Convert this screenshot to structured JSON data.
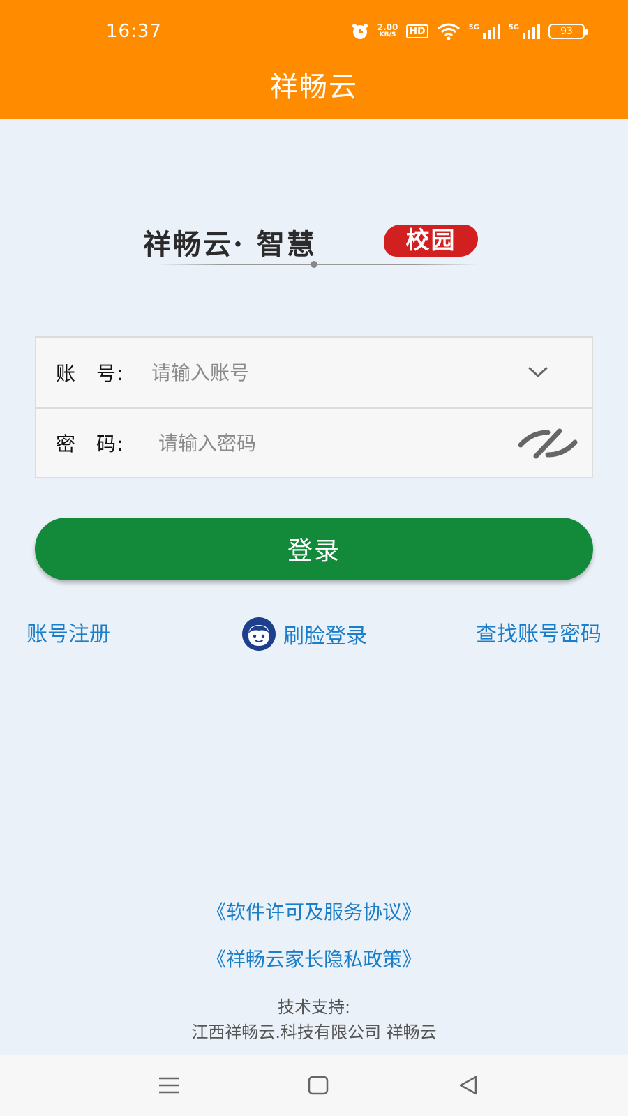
{
  "status_bar": {
    "time": "16:37",
    "net_speed_value": "2.00",
    "net_speed_unit": "KB/S",
    "hd_label": "HD",
    "signal1_label": "5G",
    "signal2_label": "5G",
    "battery": "93"
  },
  "header": {
    "title": "祥畅云"
  },
  "logo": {
    "text": "祥畅云· 智慧",
    "seal_text": "校园"
  },
  "form": {
    "account_label": "账　号:",
    "account_placeholder": "请输入账号",
    "account_value": "",
    "password_label": "密　码:",
    "password_placeholder": "请输入密码",
    "password_value": ""
  },
  "actions": {
    "login_label": "登录",
    "register_label": "账号注册",
    "face_login_label": "刷脸登录",
    "find_account_label": "查找账号密码"
  },
  "footer": {
    "agreement_label": "《软件许可及服务协议》",
    "privacy_label": "《祥畅云家长隐私政策》",
    "support_title": "技术支持:",
    "support_company": "江西祥畅云.科技有限公司 祥畅云"
  },
  "colors": {
    "header_bg": "#ff8c00",
    "login_button": "#138a3a",
    "link": "#1b7ec8",
    "page_bg": "#ebf1f8"
  }
}
